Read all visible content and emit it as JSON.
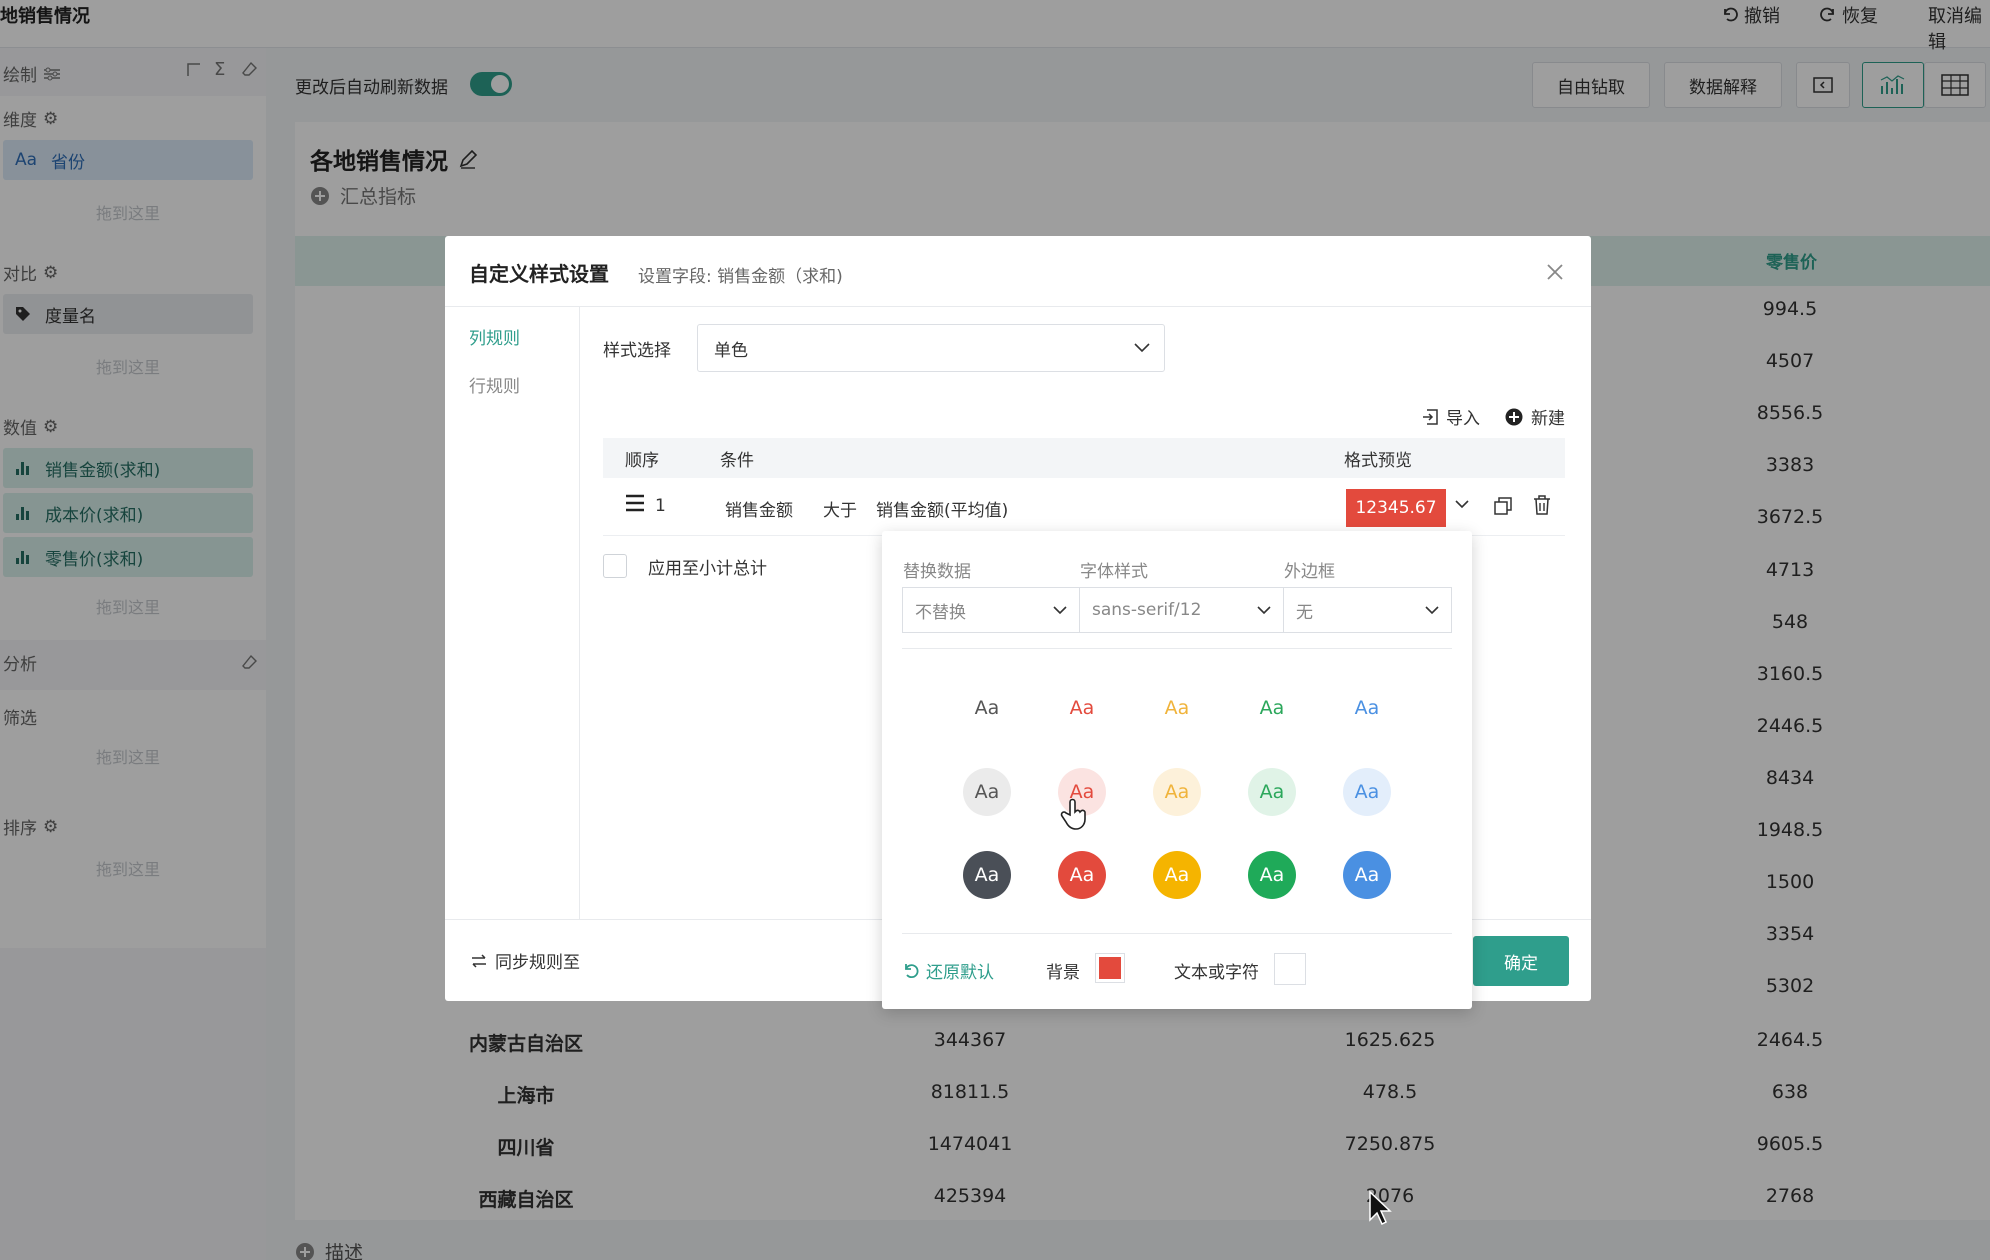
{
  "topbar": {
    "title": "地销售情况",
    "undo": "撤销",
    "redo": "恢复",
    "cancel_edit": "取消编辑"
  },
  "left_panel": {
    "header": "绘制",
    "dimension": {
      "label": "维度",
      "field": "省份",
      "field_prefix": "Aa",
      "drop": "拖到这里"
    },
    "compare": {
      "label": "对比",
      "field": "度量名",
      "drop": "拖到这里"
    },
    "values": {
      "label": "数值",
      "fields": [
        "销售金额(求和)",
        "成本价(求和)",
        "零售价(求和)"
      ],
      "drop": "拖到这里"
    },
    "analysis": {
      "label": "分析"
    },
    "filter": {
      "label": "筛选",
      "drop": "拖到这里"
    },
    "sort": {
      "label": "排序",
      "drop": "拖到这里"
    }
  },
  "toolbar": {
    "auto_refresh_label": "更改后自动刷新数据",
    "auto_refresh_on": true,
    "free_drill": "自由钻取",
    "data_explain": "数据解释"
  },
  "chart": {
    "title": "各地销售情况",
    "add_metric": "汇总指标",
    "col_retail": "零售价",
    "retail_values": [
      "994.5",
      "4507",
      "8556.5",
      "3383",
      "3672.5",
      "4713",
      "548",
      "3160.5",
      "2446.5",
      "8434",
      "1948.5",
      "1500",
      "3354",
      "5302"
    ],
    "rows": [
      {
        "province": "内蒙古自治区",
        "sales": "344367",
        "cost": "1625.625",
        "retail": "2464.5"
      },
      {
        "province": "上海市",
        "sales": "81811.5",
        "cost": "478.5",
        "retail": "638"
      },
      {
        "province": "四川省",
        "sales": "1474041",
        "cost": "7250.875",
        "retail": "9605.5"
      },
      {
        "province": "西藏自治区",
        "sales": "425394",
        "cost": "2076",
        "retail": "2768"
      }
    ],
    "description": "描述"
  },
  "modal": {
    "title": "自定义样式设置",
    "subtitle": "设置字段: 销售金额（求和)",
    "tabs": {
      "column_rule": "列规则",
      "row_rule": "行规则"
    },
    "style_label": "样式选择",
    "style_value": "单色",
    "import": "导入",
    "new": "新建",
    "table_headers": {
      "order": "顺序",
      "condition": "条件",
      "preview": "格式预览"
    },
    "rule": {
      "order": "1",
      "field": "销售金额",
      "operator": "大于",
      "target": "销售金额(平均值)",
      "preview_value": "12345.67"
    },
    "apply_subtotal": "应用至小计总计",
    "sync_rules": "同步规则至",
    "confirm": "确定"
  },
  "popover": {
    "replace_label": "替换数据",
    "replace_value": "不替换",
    "font_label": "字体样式",
    "font_value": "sans-serif/12",
    "border_label": "外边框",
    "border_value": "无",
    "swatch_text": "Aa",
    "text_colors": [
      "#555555",
      "#e34a3d",
      "#f0b33a",
      "#2ba75b",
      "#4a90e2"
    ],
    "light_bg": [
      "#ebebeb",
      "#fbe3e1",
      "#fdf1da",
      "#e0f3e7",
      "#e3eefb"
    ],
    "dark_bg": [
      "#4a4f57",
      "#e34a3d",
      "#f5b400",
      "#1faa59",
      "#4a90e2"
    ],
    "restore": "还原默认",
    "background_label": "背景",
    "text_label": "文本或字符",
    "bg_color": "#e34a3d"
  }
}
